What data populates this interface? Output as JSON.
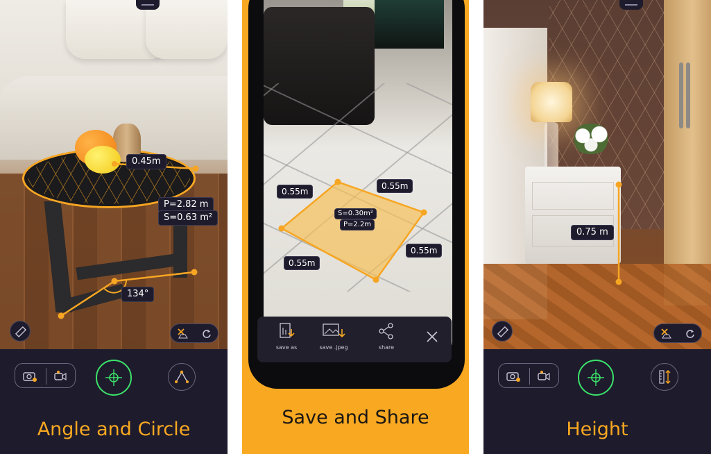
{
  "panels": {
    "left": {
      "caption": "Angle and Circle",
      "measurements": {
        "diameter": "0.45m",
        "perimeter": "P=2.82 m",
        "area": "S=0.63 m²",
        "angle": "134°"
      },
      "icons": {
        "ruler": "ruler-icon",
        "clear": "clear-icon",
        "undo": "undo-icon",
        "photo": "camera-icon",
        "video": "video-icon",
        "target": "crosshair-icon",
        "mode": "angle-icon"
      }
    },
    "middle": {
      "caption": "Save and Share",
      "measurements": {
        "top_left": "0.55m",
        "top_right": "0.55m",
        "area": "S=0.30m²",
        "perimeter": "P=2.2m",
        "bottom_left": "0.55m",
        "bottom_right": "0.55m"
      },
      "share_bar": {
        "save_as": "save as",
        "save_jpeg": "save .jpeg",
        "share": "share",
        "close": "close-icon"
      }
    },
    "right": {
      "caption": "Height",
      "measurements": {
        "height": "0.75 m"
      },
      "icons": {
        "ruler": "ruler-icon",
        "clear": "clear-icon",
        "undo": "undo-icon",
        "photo": "camera-icon",
        "video": "video-icon",
        "target": "crosshair-icon",
        "mode": "height-icon"
      }
    }
  },
  "colors": {
    "accent": "#f8a821",
    "toolbar": "#1e1b2c",
    "target_ring": "#3ce26a"
  }
}
